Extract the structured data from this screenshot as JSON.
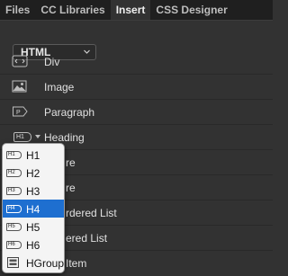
{
  "tabs": [
    {
      "label": "Files"
    },
    {
      "label": "CC Libraries"
    },
    {
      "label": "Insert",
      "active": true
    },
    {
      "label": "CSS Designer"
    }
  ],
  "category": {
    "selected": "HTML"
  },
  "items": [
    {
      "label": "Div",
      "icon": "div-icon"
    },
    {
      "label": "Image",
      "icon": "image-icon"
    },
    {
      "label": "Paragraph",
      "icon": "paragraph-icon"
    },
    {
      "label": "Heading",
      "icon": "heading-icon",
      "badge": "H1"
    },
    {
      "label": "re"
    },
    {
      "label": "re"
    },
    {
      "label": "rdered List"
    },
    {
      "label": "ered List"
    },
    {
      "label": "Item"
    }
  ],
  "heading_menu": [
    {
      "label": "H1",
      "badge": "H1"
    },
    {
      "label": "H2",
      "badge": "H2"
    },
    {
      "label": "H3",
      "badge": "H3"
    },
    {
      "label": "H4",
      "badge": "H4",
      "selected": true
    },
    {
      "label": "H5",
      "badge": "H5"
    },
    {
      "label": "H6",
      "badge": "H6"
    },
    {
      "label": "HGroup",
      "icon": "hgroup-icon"
    }
  ],
  "colors": {
    "accent": "#1e6fd0",
    "panel": "#323232",
    "tabbar": "#1f1f1f"
  }
}
